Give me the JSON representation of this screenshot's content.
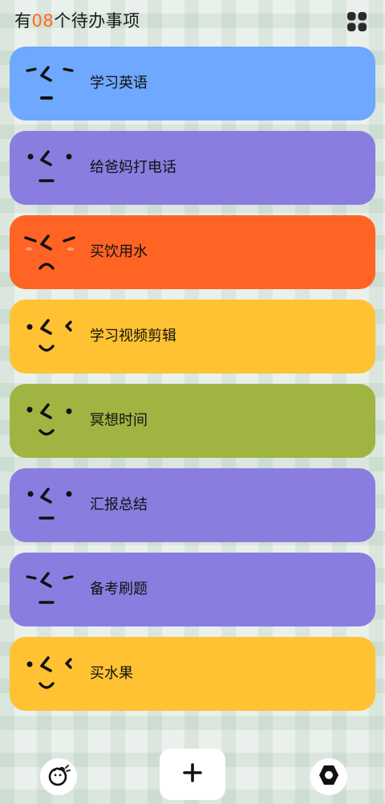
{
  "header": {
    "title_prefix": "有",
    "count": "08",
    "title_suffix": "个待办事项",
    "count_color": "#ff6a1e",
    "menu_icon": "grid-icon"
  },
  "todos": [
    {
      "label": "学习英语",
      "color": "#6ea8ff",
      "face": "neutral-face-icon"
    },
    {
      "label": "给爸妈打电话",
      "color": "#8a7de0",
      "face": "calm-face-icon"
    },
    {
      "label": "买饮用水",
      "color": "#ff6424",
      "face": "sad-face-icon"
    },
    {
      "label": "学习视频剪辑",
      "color": "#ffc232",
      "face": "smile-face-icon"
    },
    {
      "label": "冥想时间",
      "color": "#a0b442",
      "face": "smile-face-icon"
    },
    {
      "label": "汇报总结",
      "color": "#8a7de0",
      "face": "calm-face-icon"
    },
    {
      "label": "备考刷题",
      "color": "#8a7de0",
      "face": "neutral-face-icon"
    },
    {
      "label": "买水果",
      "color": "#ffc232",
      "face": "smile-face-icon"
    }
  ],
  "bottom_bar": {
    "left_icon": "tomato-icon",
    "center_icon": "plus-icon",
    "right_icon": "hexagon-settings-icon"
  }
}
